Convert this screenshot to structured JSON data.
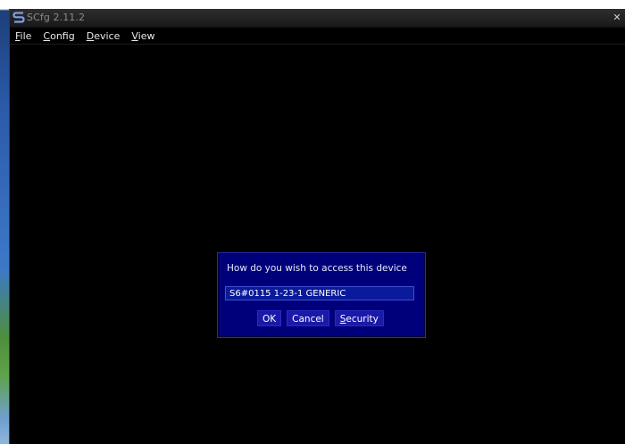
{
  "window": {
    "title": "SCfg 2.11.2",
    "close_glyph": "✕"
  },
  "menu": {
    "items": [
      {
        "label_acc": "F",
        "label_rest": "ile"
      },
      {
        "label_acc": "C",
        "label_rest": "onfig"
      },
      {
        "label_acc": "D",
        "label_rest": "evice"
      },
      {
        "label_acc": "V",
        "label_rest": "iew"
      }
    ]
  },
  "dialog": {
    "prompt": "How do you wish to access this device",
    "device_entry": "S6#0115 1-23-1 GENERIC",
    "buttons": {
      "ok": "OK",
      "cancel": "Cancel",
      "security_acc": "S",
      "security_rest": "ecurity"
    }
  },
  "colors": {
    "window_bg": "#000000",
    "dialog_bg": "#00007a",
    "text": "#e8e8ff"
  },
  "icons": {
    "app": "s-logo-icon",
    "close": "close-icon"
  }
}
